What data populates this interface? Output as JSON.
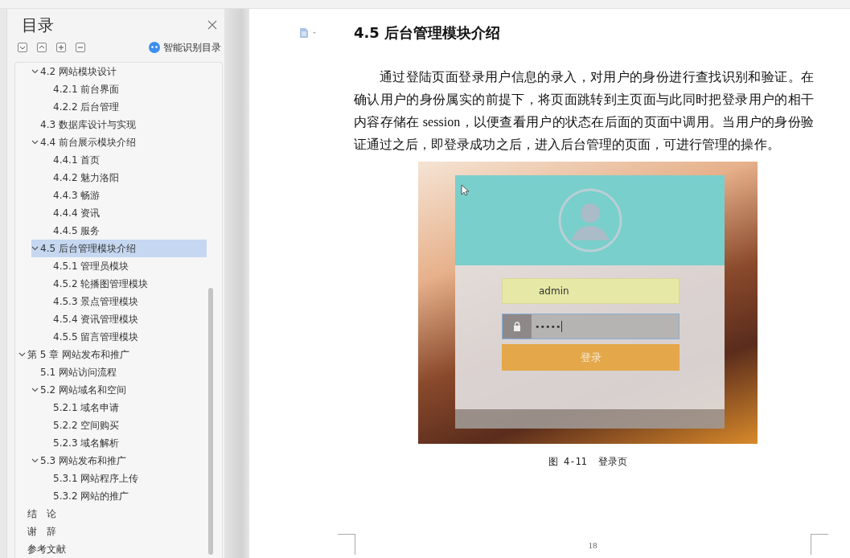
{
  "sidebar": {
    "title": "目录",
    "smart_button": "智能识别目录",
    "tree": [
      {
        "children": [
          {
            "label": "4.2  网站模块设计",
            "selected": false,
            "expanded": true,
            "children": [
              {
                "label": "4.2.1  前台界面",
                "selected": false
              },
              {
                "label": "4.2.2  后台管理",
                "selected": false
              }
            ]
          },
          {
            "label": "4.3  数据库设计与实现",
            "selected": false
          },
          {
            "label": "4.4  前台展示模块介绍",
            "selected": false,
            "expanded": true,
            "children": [
              {
                "label": "4.4.1  首页",
                "selected": false
              },
              {
                "label": "4.4.2  魅力洛阳",
                "selected": false
              },
              {
                "label": "4.4.3  畅游",
                "selected": false
              },
              {
                "label": "4.4.4  资讯",
                "selected": false
              },
              {
                "label": "4.4.5  服务",
                "selected": false
              }
            ]
          },
          {
            "label": "4.5  后台管理模块介绍",
            "selected": true,
            "expanded": true,
            "children": [
              {
                "label": "4.5.1  管理员模块",
                "selected": false
              },
              {
                "label": "4.5.2  轮播图管理模块",
                "selected": false
              },
              {
                "label": "4.5.3  景点管理模块",
                "selected": false
              },
              {
                "label": "4.5.4  资讯管理模块",
                "selected": false
              },
              {
                "label": "4.5.5  留言管理模块",
                "selected": false
              }
            ]
          }
        ]
      },
      {
        "label": "第 5 章  网站发布和推广",
        "selected": false,
        "expanded": true,
        "children": [
          {
            "label": "5.1  网站访问流程",
            "selected": false
          },
          {
            "label": "5.2  网站域名和空间",
            "selected": false,
            "expanded": true,
            "children": [
              {
                "label": "5.2.1  域名申请",
                "selected": false
              },
              {
                "label": "5.2.2  空间购买",
                "selected": false
              },
              {
                "label": "5.2.3  域名解析",
                "selected": false
              }
            ]
          },
          {
            "label": "5.3  网站发布和推广",
            "selected": false,
            "expanded": true,
            "children": [
              {
                "label": "5.3.1  网站程序上传",
                "selected": false
              },
              {
                "label": "5.3.2  网站的推广",
                "selected": false
              }
            ]
          }
        ]
      },
      {
        "label": "结　论",
        "selected": false
      },
      {
        "label": "谢　辞",
        "selected": false
      },
      {
        "label": "参考文献",
        "selected": false
      }
    ]
  },
  "document": {
    "heading": "4.5  后台管理模块介绍",
    "paragraph": "通过登陆页面登录用户信息的录入，对用户的身份进行查找识别和验证。在确认用户的身份属实的前提下，将页面跳转到主页面与此同时把登录用户的相干内容存储在 session，以便查看用户的状态在后面的页面中调用。当用户的身份验证通过之后，即登录成功之后，进入后台管理的页面，可进行管理的操作。",
    "figure": {
      "login": {
        "username": "admin",
        "password": "•••••",
        "button": "登录"
      },
      "caption": "图 4-11  登录页"
    },
    "page_number": "18"
  }
}
